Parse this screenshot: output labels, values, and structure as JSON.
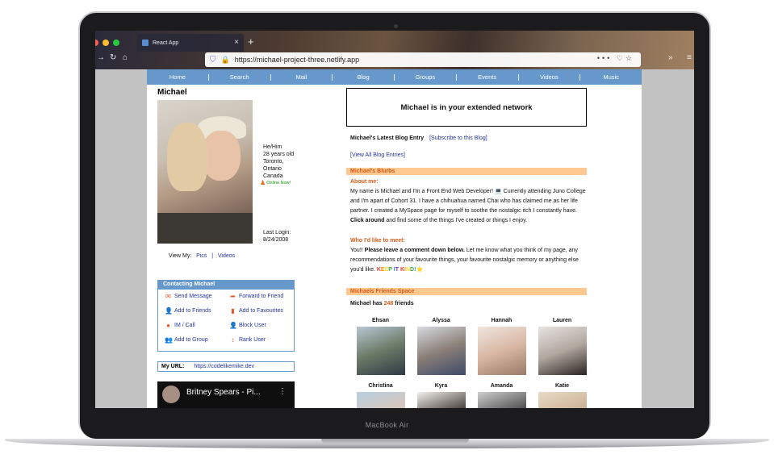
{
  "device": {
    "label": "MacBook Air"
  },
  "browser": {
    "tab_title": "React App",
    "url": "https://michael-project-three.netlify.app",
    "overflow_menu": "•••",
    "new_tab_symbol": "+",
    "tab_close_symbol": "×"
  },
  "nav": {
    "items": [
      "Home",
      "Search",
      "Mail",
      "Blog",
      "Groups",
      "Events",
      "Videos",
      "Music"
    ]
  },
  "profile": {
    "name": "Michael",
    "details": [
      "He/Him",
      "28 years old",
      "Toronto,",
      "Ontario",
      "Canada"
    ],
    "online": "Online Now!",
    "last_login_label": "Last Login:",
    "last_login_date": "8/24/2008",
    "view_my_label": "View My:",
    "view_my_pics": "Pics",
    "view_my_sep": "|",
    "view_my_videos": "Videos"
  },
  "contact": {
    "title": "Contacting Michael",
    "items": [
      {
        "label": "Send Message",
        "icon": "envelope-icon"
      },
      {
        "label": "Forward to Friend",
        "icon": "forward-arrow-icon"
      },
      {
        "label": "Add to Friends",
        "icon": "add-user-icon"
      },
      {
        "label": "Add to Favourites",
        "icon": "bookmark-icon"
      },
      {
        "label": "IM / Call",
        "icon": "chat-bubble-icon"
      },
      {
        "label": "Block User",
        "icon": "block-user-icon"
      },
      {
        "label": "Add to Group",
        "icon": "group-icon"
      },
      {
        "label": "Rank User",
        "icon": "rank-icon"
      }
    ]
  },
  "my_url": {
    "label": "My URL:",
    "value": "https://codelikemike.dev"
  },
  "video": {
    "title": "Britney Spears - Pi...",
    "menu": "⋮"
  },
  "network": {
    "text": "Michael is in your extended network"
  },
  "blog": {
    "latest_label": "Michael's Latest Blog Entry",
    "subscribe_link": "[Subscribe to this Blog]",
    "view_all_link": "[View All Blog Entries]"
  },
  "blurbs": {
    "header": "Michael's Blurbs",
    "about_title": "About me:",
    "about_text_1": "My name is Michael and I'm a Front End Web Developer! 💻 Currently attending Juno College and I'm apart of Cohort 31. I have a chihuahua named Chai who has claimed me as her life partner. I created a MySpace page for myself to soothe the nostalgic itch I constantly have. ",
    "about_bold": "Click around",
    "about_text_2": " and find some of the things I've created or things I enjoy.",
    "meet_title": "Who I'd like to meet:",
    "meet_text_1": "You!! ",
    "meet_bold": "Please leave a comment down below.",
    "meet_text_2": " Let me know what you think of my page, any recommendations of your favourite things, your favourite nostalgic memory or anything else you'd like. ",
    "meet_kind": "KEEP IT KIND!",
    "meet_kind_emoji": "⭐"
  },
  "friends": {
    "header": "Michaels Friends Space",
    "count_prefix": "Michael has ",
    "count": "248",
    "count_suffix": " friends",
    "list": [
      {
        "name": "Ehsan"
      },
      {
        "name": "Alyssa"
      },
      {
        "name": "Hannah"
      },
      {
        "name": "Lauren"
      },
      {
        "name": "Christina"
      },
      {
        "name": "Kyra"
      },
      {
        "name": "Amanda"
      },
      {
        "name": "Katie"
      }
    ]
  },
  "colors": {
    "nav_bar": "#6698cb",
    "section_header_bg": "#ffc891",
    "section_header_text": "#d65a17",
    "link": "#22349a"
  }
}
